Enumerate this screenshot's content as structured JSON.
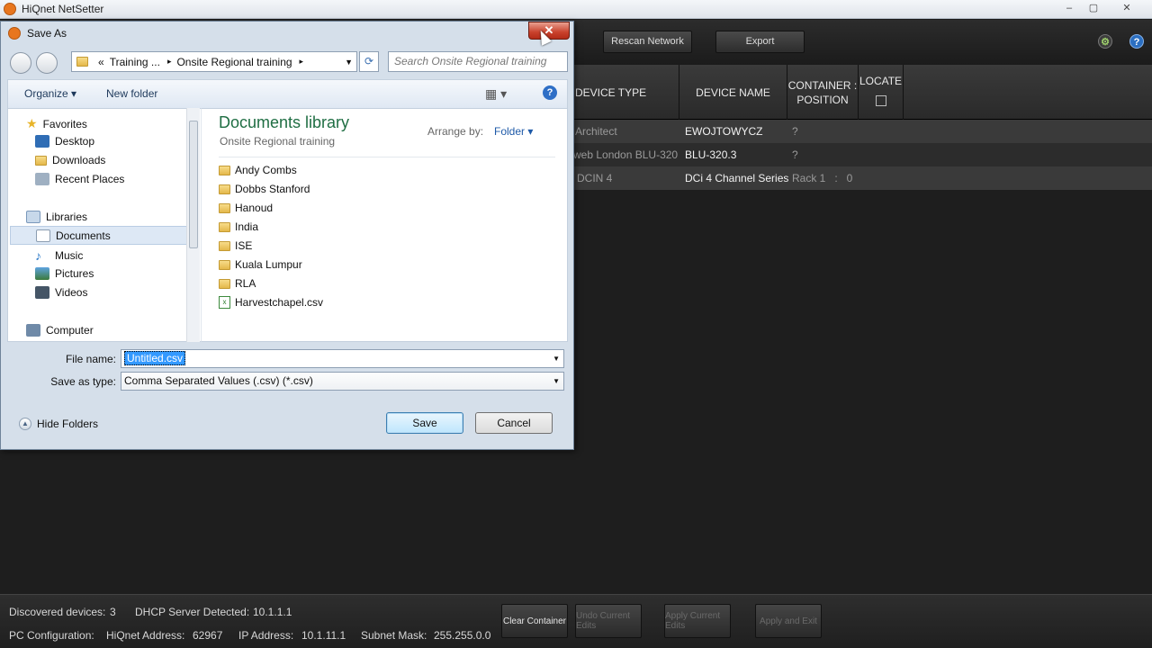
{
  "app": {
    "title": "HiQnet NetSetter",
    "min": "–",
    "max": "▢",
    "close": "✕",
    "toolbar": {
      "rescan": "Rescan Network",
      "export": "Export"
    },
    "columns": {
      "device_type": "DEVICE TYPE",
      "device_name": "DEVICE NAME",
      "container_position": "CONTAINER : POSITION",
      "locate": "LOCATE"
    },
    "rows": [
      {
        "type": "Architect",
        "name": "EWOJTOWYCZ",
        "position": "?"
      },
      {
        "type": "web London BLU-320",
        "name": "BLU-320.3",
        "position": "?"
      },
      {
        "type": "DCIN 4",
        "name": "DCi 4 Channel Series",
        "position": "Rack 1   :   0"
      }
    ],
    "status": {
      "discovered_label": "Discovered devices:",
      "discovered_value": "3",
      "dhcp_label": "DHCP Server Detected:",
      "dhcp_value": "10.1.1.1",
      "pc_config_label": "PC Configuration:",
      "hiqnet_label": "HiQnet Address:",
      "hiqnet_value": "62967",
      "ip_label": "IP Address:",
      "ip_value": "10.1.11.1",
      "subnet_label": "Subnet Mask:",
      "subnet_value": "255.255.0.0"
    },
    "bottom_buttons": {
      "clear": "Clear Container",
      "undo": "Undo Current Edits",
      "apply": "Apply Current Edits",
      "apply_exit": "Apply and Exit"
    }
  },
  "dialog": {
    "title": "Save As",
    "close": "✕",
    "breadcrumb": [
      "«",
      "Training ...",
      "▸",
      "Onsite Regional training",
      "▸"
    ],
    "search_placeholder": "Search Onsite Regional training",
    "organize": "Organize ▾",
    "new_folder": "New folder",
    "nav": {
      "favorites": "Favorites",
      "desktop": "Desktop",
      "downloads": "Downloads",
      "recent": "Recent Places",
      "libraries": "Libraries",
      "documents": "Documents",
      "music": "Music",
      "pictures": "Pictures",
      "videos": "Videos",
      "computer": "Computer"
    },
    "library_title": "Documents library",
    "library_subtitle": "Onsite Regional training",
    "arrange_label": "Arrange by:",
    "arrange_value": "Folder ▾",
    "files": [
      "Andy Combs",
      "Dobbs Stanford",
      "Hanoud",
      "India",
      "ISE",
      "Kuala Lumpur",
      "RLA",
      "Harvestchapel.csv"
    ],
    "file_name_label": "File name:",
    "file_name_value": "Untitled.csv",
    "save_type_label": "Save as type:",
    "save_type_value": "Comma Separated Values (.csv) (*.csv)",
    "hide_folders": "Hide Folders",
    "save": "Save",
    "cancel": "Cancel"
  }
}
